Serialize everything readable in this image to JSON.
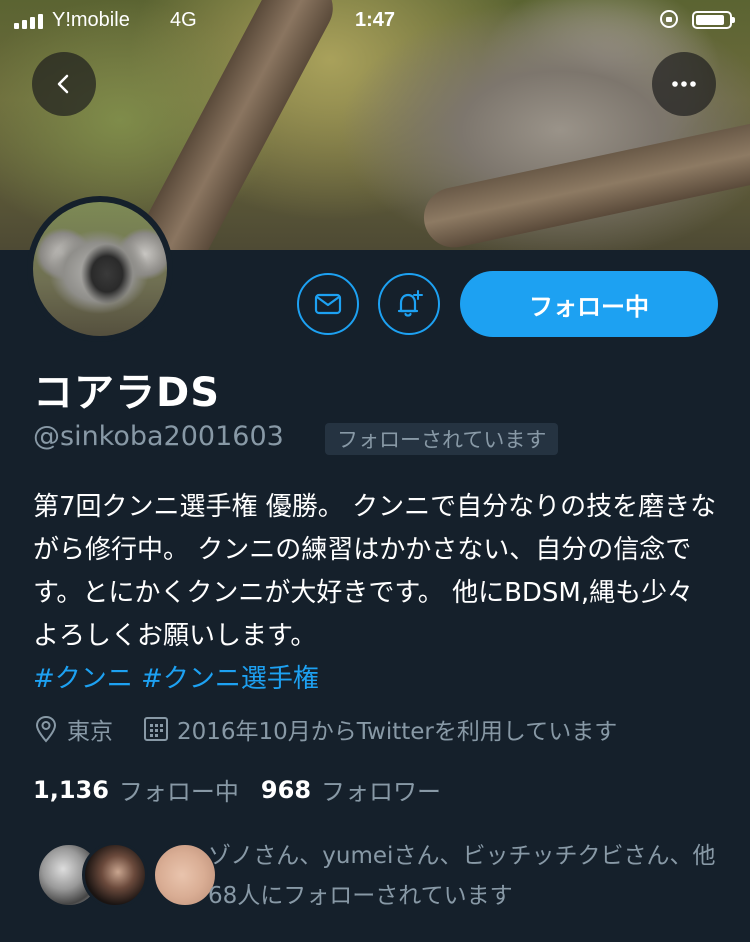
{
  "status_bar": {
    "carrier": "Y!mobile",
    "network": "4G",
    "time": "1:47"
  },
  "profile": {
    "display_name": "コアラDS",
    "handle": "@sinkoba2001603",
    "follows_you_label": "フォローされています",
    "follow_button_label": "フォロー中",
    "bio_text": "第7回クンニ選手権 優勝。 クンニで自分なりの技を磨きながら修行中。 クンニの練習はかかさない、自分の信念です。とにかくクンニが大好きです。 他にBDSM,縄も少々 よろしくお願いします。",
    "bio_hashtags": [
      "#クンニ",
      "#クンニ選手権"
    ],
    "location": "東京",
    "joined": "2016年10月からTwitterを利用しています",
    "following_count": "1,136",
    "following_label": "フォロー中",
    "followers_count": "968",
    "followers_label": "フォロワー",
    "followed_by_text": "ゾノさん、yumeiさん、ビッチッチクビさん、他68人にフォローされています"
  },
  "icons": {
    "back": "back-arrow-icon",
    "more": "more-icon",
    "mail": "mail-icon",
    "bell": "bell-plus-icon",
    "location": "location-pin-icon",
    "calendar": "calendar-icon"
  },
  "colors": {
    "background": "#15202b",
    "accent": "#1da1f2",
    "secondary_text": "#8899a6"
  }
}
